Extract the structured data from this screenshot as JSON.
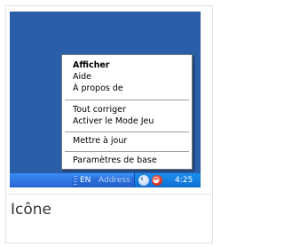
{
  "context_menu": {
    "items": [
      {
        "label": "Afficher",
        "bold": true
      },
      {
        "label": "Aide"
      },
      {
        "label": "À propos de"
      },
      {
        "label": "Tout corriger"
      },
      {
        "label": "Activer le Mode Jeu"
      },
      {
        "label": "Mettre à jour"
      },
      {
        "label": "Paramètres de base"
      }
    ]
  },
  "taskbar": {
    "language": "EN",
    "address_label": "Address",
    "clock": "4:25",
    "tray_icons": [
      "expand-tray-icon",
      "app-tray-icon"
    ]
  },
  "caption": "Icône",
  "colors": {
    "desktop": "#2a5ea8",
    "taskbar": "#245ec8",
    "tray": "#1b8ff0",
    "app_icon": "#d22a1a"
  }
}
